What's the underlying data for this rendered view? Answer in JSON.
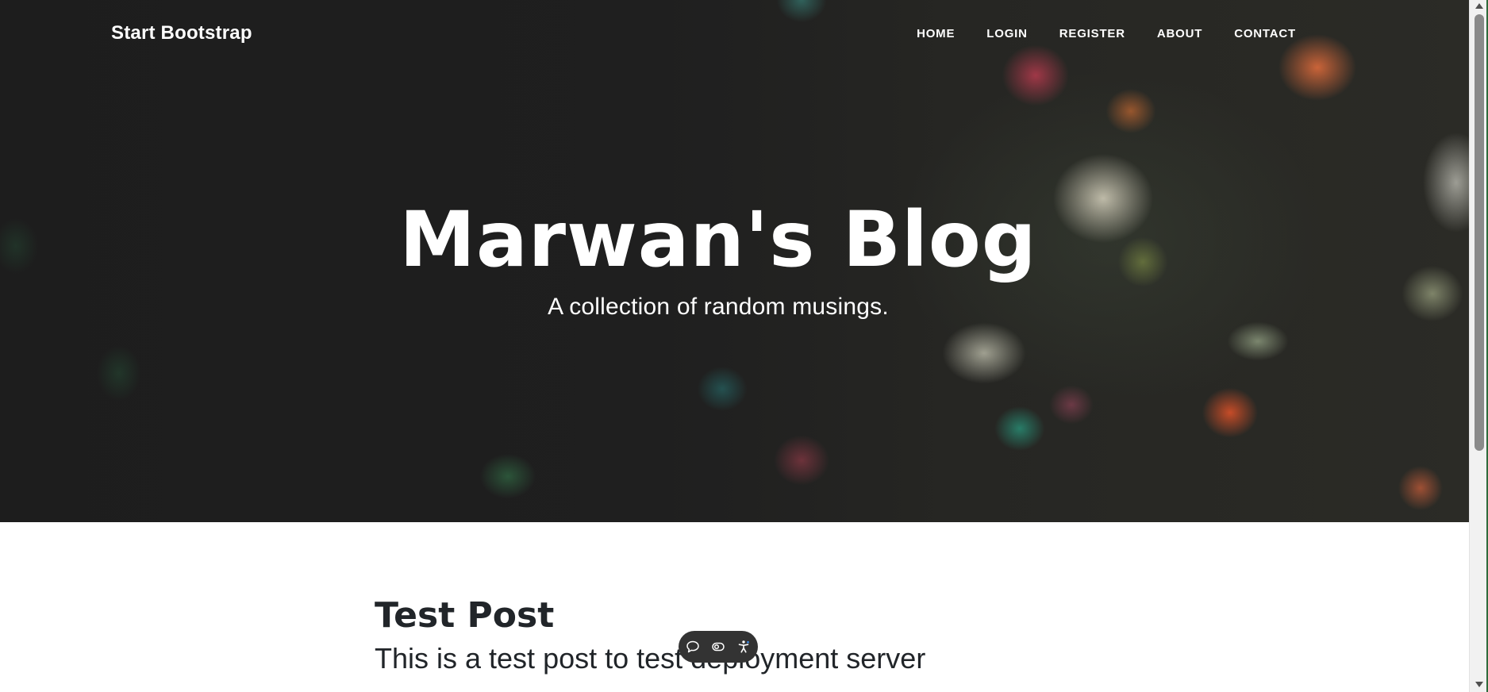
{
  "navbar": {
    "brand": "Start Bootstrap",
    "links": [
      {
        "label": "HOME"
      },
      {
        "label": "LOGIN"
      },
      {
        "label": "REGISTER"
      },
      {
        "label": "ABOUT"
      },
      {
        "label": "CONTACT"
      }
    ]
  },
  "header": {
    "title": "Marwan's Blog",
    "subtitle": "A collection of random musings."
  },
  "posts": [
    {
      "title": "Test Post",
      "subtitle": "This is a test post to test deployment server"
    }
  ],
  "accessibility_toolbar": {
    "icons": [
      "chat-bubble-icon",
      "contrast-toggle-icon",
      "accessibility-person-icon"
    ]
  },
  "colors": {
    "hero_overlay": "#1f1f1f",
    "text_dark": "#212529",
    "toolbar_bg": "#333333",
    "nav_text": "#ffffff"
  }
}
